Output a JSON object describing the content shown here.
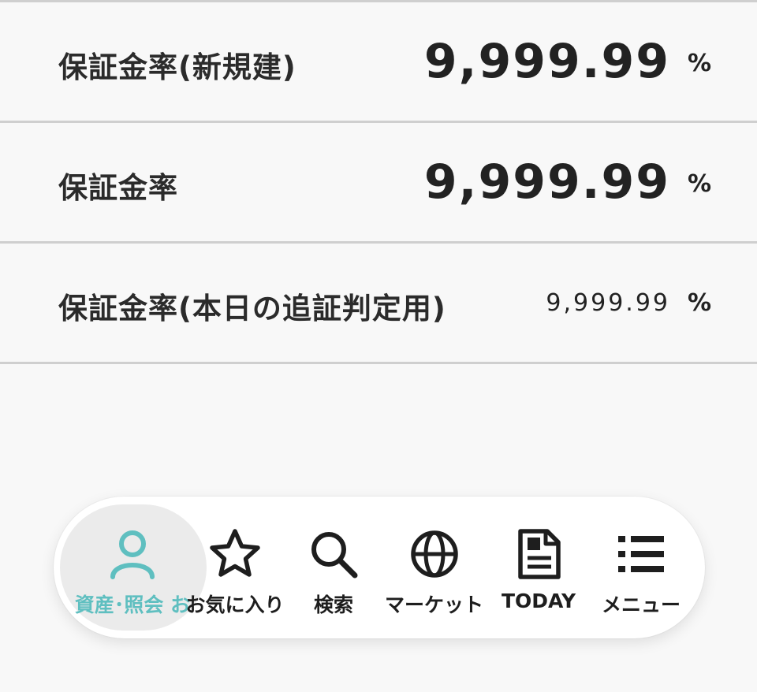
{
  "rows": [
    {
      "label": "保証金率(新規建)",
      "value": "9,999.99",
      "unit": "%"
    },
    {
      "label": "保証金率",
      "value": "9,999.99",
      "unit": "%"
    },
    {
      "label": "保証金率(本日の追証判定用)",
      "value": "9,999.99",
      "unit": "%"
    }
  ],
  "nav": {
    "accent_color": "#5fbfc0",
    "items": [
      {
        "label": "資産･照会 お",
        "icon": "person-icon",
        "active": true
      },
      {
        "label": "お気に入り",
        "icon": "star-icon"
      },
      {
        "label": "検索",
        "icon": "search-icon"
      },
      {
        "label": "マーケット",
        "icon": "globe-icon"
      },
      {
        "label": "TODAY",
        "icon": "document-icon"
      },
      {
        "label": "メニュー",
        "icon": "list-icon"
      }
    ]
  }
}
